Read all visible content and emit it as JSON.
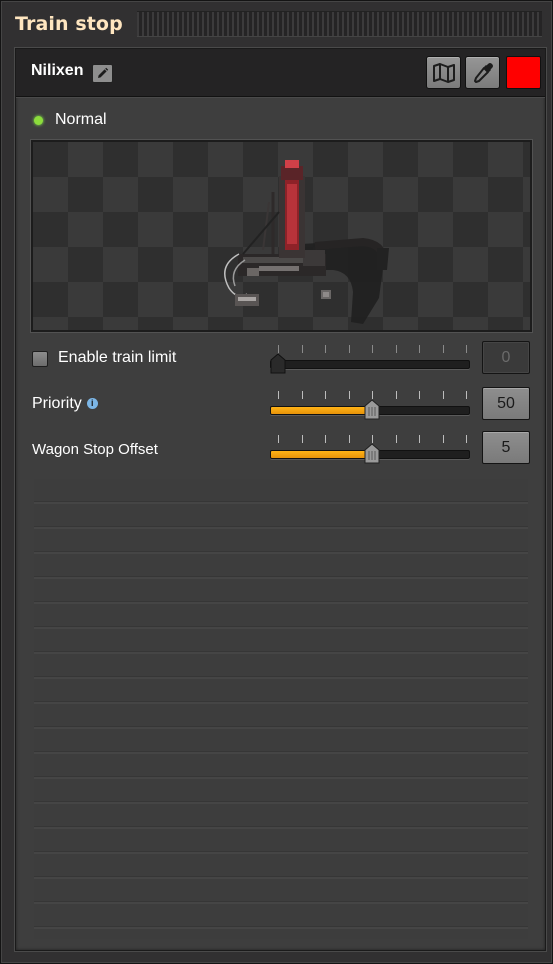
{
  "window": {
    "title": "Train stop"
  },
  "station": {
    "name": "Nilixen",
    "color": "#ff0000",
    "status": {
      "text": "Normal",
      "color": "#8cdc3c"
    }
  },
  "icons": {
    "edit": "pencil-icon",
    "map": "map-icon",
    "color_picker": "eyedropper-icon"
  },
  "settings": {
    "train_limit": {
      "label": "Enable train limit",
      "checked": false,
      "value": "0",
      "slider_fraction": 0.0,
      "enabled": false
    },
    "priority": {
      "label": "Priority",
      "value": "50",
      "slider_fraction": 0.5,
      "has_info": true
    },
    "wagon_stop_offset": {
      "label": "Wagon Stop Offset",
      "value": "5",
      "slider_fraction": 0.5
    }
  }
}
